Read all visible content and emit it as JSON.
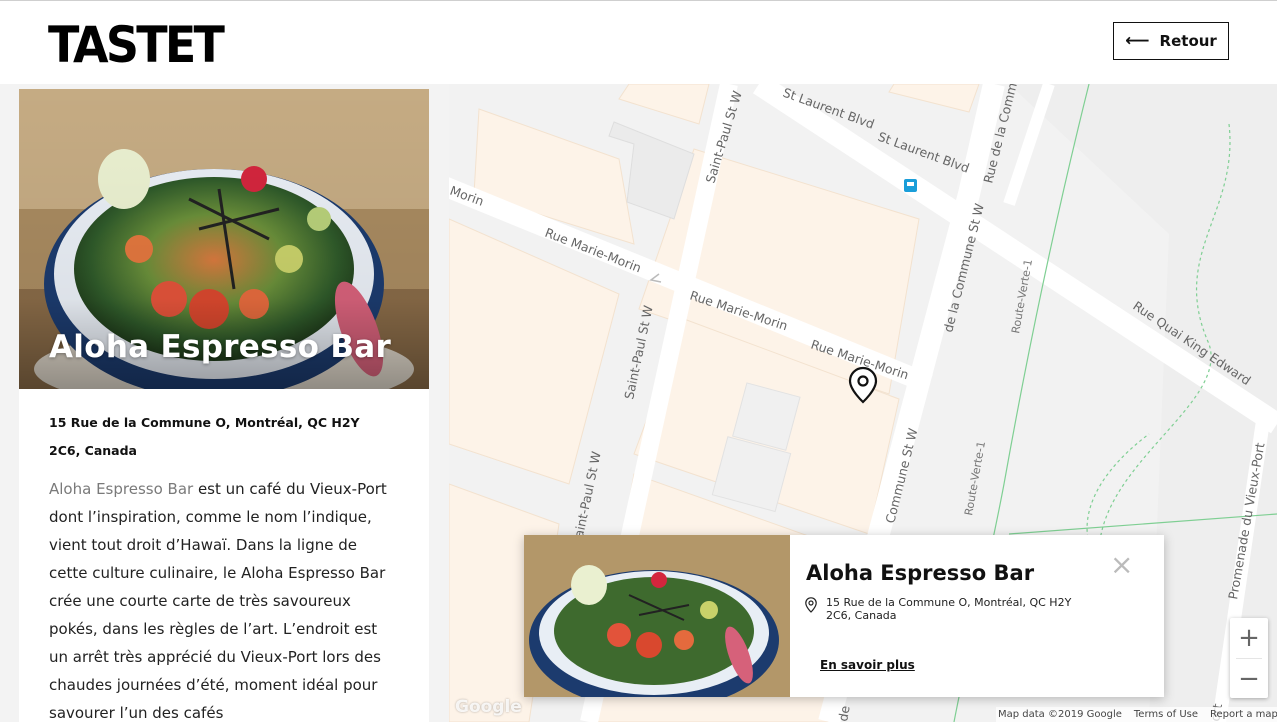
{
  "header": {
    "logo": "TASTET",
    "back_label": "Retour"
  },
  "place": {
    "name": "Aloha Espresso Bar",
    "address": "15 Rue de la Commune O, Montréal, QC H2Y 2C6, Canada",
    "description_highlight": "Aloha Espresso Bar",
    "description_rest": " est un café du Vieux-Port dont l’inspiration, comme le nom l’indique, vient tout droit d’Hawaï. Dans la ligne de cette culture culinaire, le Aloha Espresso Bar crée une courte carte de très savoureux pokés, dans les règles de l’art. L’endroit est un arrêt très apprécié du Vieux-Port lors des chaudes journées d’été, moment idéal pour savourer l’un des cafés"
  },
  "map": {
    "streets": {
      "st_laurent_1": "St Laurent Blvd",
      "st_laurent_2": "St Laurent Blvd",
      "saint_paul_1": "Saint-Paul St W",
      "saint_paul_2": "Saint-Paul St W",
      "saint_paul_3": "Saint-Paul St W",
      "marie_morin_1": "Rue Marie-Morin",
      "marie_morin_2": "Rue Marie-Morin",
      "marie_morin_3": "Rue Marie-Morin",
      "morin": "Morin",
      "commune_1": "de la Commune St W",
      "commune_2": "Commune St W",
      "commune_3": "Rue de la Commu",
      "quai": "Rue Quai King Edward",
      "route_verte_1": "Route-Verte-1",
      "route_verte_2": "Route-Verte-1",
      "promenade": "Promenade du Vieux-Port",
      "ort": "ort",
      "de": "de"
    },
    "google": "Google",
    "attribution": {
      "data": "Map data ©2019 Google",
      "terms": "Terms of Use",
      "report": "Report a map error"
    },
    "zoom_in": "+",
    "zoom_out": "−"
  },
  "popup": {
    "title": "Aloha Espresso Bar",
    "address": "15 Rue de la Commune O, Montréal, QC H2Y 2C6, Canada",
    "link": "En savoir plus",
    "close": "×"
  },
  "colors": {
    "accent": "#111111",
    "map_block": "#fdf3e8",
    "map_road": "#ffffff",
    "path_green": "#7fcf93",
    "transit": "#1a9ed9"
  },
  "icons": {
    "back": "arrow-left-icon",
    "pin": "map-pin-icon",
    "close": "close-icon",
    "transit": "bus-stop-icon"
  }
}
